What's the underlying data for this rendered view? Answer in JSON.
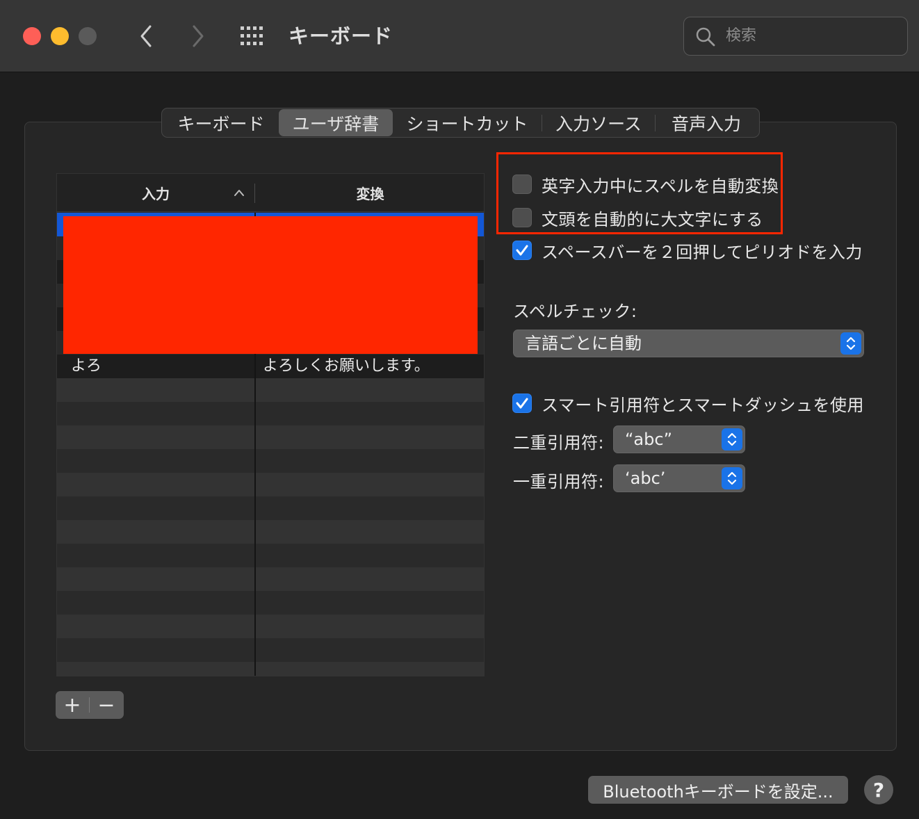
{
  "window": {
    "title": "キーボード",
    "search_placeholder": "検索"
  },
  "tabs": [
    {
      "label": "キーボード",
      "selected": false
    },
    {
      "label": "ユーザ辞書",
      "selected": true
    },
    {
      "label": "ショートカット",
      "selected": false
    },
    {
      "label": "入力ソース",
      "selected": false
    },
    {
      "label": "音声入力",
      "selected": false
    }
  ],
  "dictionary": {
    "col_input": "入力",
    "col_conversion": "変換",
    "rows": [
      {
        "input": "よろ",
        "conversion": "よろしくお願いします。"
      }
    ],
    "add_label": "+",
    "remove_label": "−"
  },
  "options": {
    "autocorrect": {
      "label": "英字入力中にスペルを自動変換",
      "checked": false
    },
    "capitalize": {
      "label": "文頭を自動的に大文字にする",
      "checked": false
    },
    "double_space_period": {
      "label": "スペースバーを２回押してピリオドを入力",
      "checked": true
    },
    "spell_check_label": "スペルチェック:",
    "spell_check_value": "言語ごとに自動",
    "smart_quotes": {
      "label": "スマート引用符とスマートダッシュを使用",
      "checked": true
    },
    "double_quote_label": "二重引用符:",
    "double_quote_value": "“abc”",
    "single_quote_label": "一重引用符:",
    "single_quote_value": "‘abc’"
  },
  "footer": {
    "bluetooth_button": "Bluetoothキーボードを設定...",
    "help": "?"
  },
  "colors": {
    "accent": "#1a73e8",
    "highlight_box": "#ff2600",
    "redaction": "#ff2600"
  }
}
